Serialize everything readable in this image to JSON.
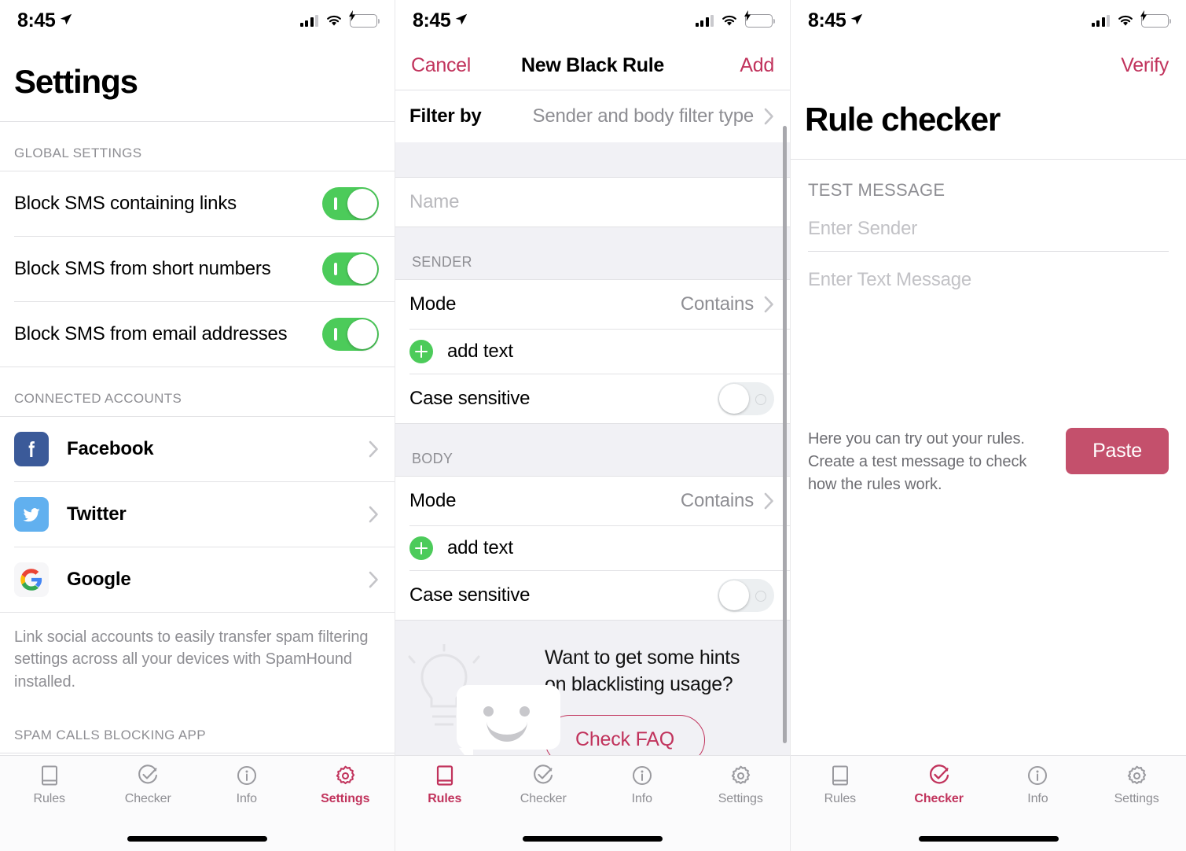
{
  "status_bar": {
    "time": "8:45",
    "location_icon": "location-arrow-icon",
    "signal_icon": "cellular-signal-icon",
    "wifi_icon": "wifi-icon",
    "battery_icon": "battery-charging-icon"
  },
  "tab_bar": {
    "items": [
      {
        "label": "Rules",
        "icon": "book-icon"
      },
      {
        "label": "Checker",
        "icon": "check-circle-icon"
      },
      {
        "label": "Info",
        "icon": "info-circle-icon"
      },
      {
        "label": "Settings",
        "icon": "gear-icon"
      }
    ]
  },
  "colors": {
    "accent": "#c1335c",
    "toggle_on": "#4ccb5a",
    "paste_button": "#c4506c",
    "facebook": "#3b5a99",
    "twitter": "#61b0ef",
    "muted_text": "#8e8e93"
  },
  "screen1": {
    "title": "Settings",
    "active_tab": "Settings",
    "global_section": {
      "header": "GLOBAL SETTINGS",
      "rows": [
        {
          "label": "Block SMS containing links",
          "toggle": "on"
        },
        {
          "label": "Block SMS from short numbers",
          "toggle": "on"
        },
        {
          "label": "Block SMS from email addresses",
          "toggle": "on"
        }
      ]
    },
    "accounts_section": {
      "header": "CONNECTED ACCOUNTS",
      "rows": [
        {
          "label": "Facebook",
          "icon": "facebook-icon"
        },
        {
          "label": "Twitter",
          "icon": "twitter-icon"
        },
        {
          "label": "Google",
          "icon": "google-icon"
        }
      ],
      "footnote": "Link social accounts to easily transfer spam filtering settings across all your devices with SpamHound installed."
    },
    "spam_calls_section": {
      "header": "SPAM CALLS BLOCKING APP"
    }
  },
  "screen2": {
    "nav": {
      "cancel": "Cancel",
      "title": "New Black Rule",
      "add": "Add"
    },
    "active_tab": "Rules",
    "filter_row": {
      "label": "Filter by",
      "value": "Sender and body filter type"
    },
    "name_field": {
      "placeholder": "Name",
      "value": ""
    },
    "sender_section": {
      "header": "SENDER",
      "mode": {
        "label": "Mode",
        "value": "Contains"
      },
      "add_text": {
        "label": "add text",
        "icon": "plus-circle-icon"
      },
      "case_sensitive": {
        "label": "Case sensitive",
        "toggle": "off"
      }
    },
    "body_section": {
      "header": "BODY",
      "mode": {
        "label": "Mode",
        "value": "Contains"
      },
      "add_text": {
        "label": "add text",
        "icon": "plus-circle-icon"
      },
      "case_sensitive": {
        "label": "Case sensitive",
        "toggle": "off"
      }
    },
    "faq_banner": {
      "question": "Want to get some hints on blacklisting usage?",
      "button": "Check FAQ",
      "illustration": "lightbulb-speech-bubble-smiley-icon"
    }
  },
  "screen3": {
    "verify": "Verify",
    "title": "Rule checker",
    "active_tab": "Checker",
    "section_label": "TEST MESSAGE",
    "sender_field": {
      "placeholder": "Enter Sender",
      "value": ""
    },
    "message_field": {
      "placeholder": "Enter Text Message",
      "value": ""
    },
    "help_text": "Here you can try out your rules. Create a test message to check how the rules work.",
    "paste_button": "Paste"
  }
}
